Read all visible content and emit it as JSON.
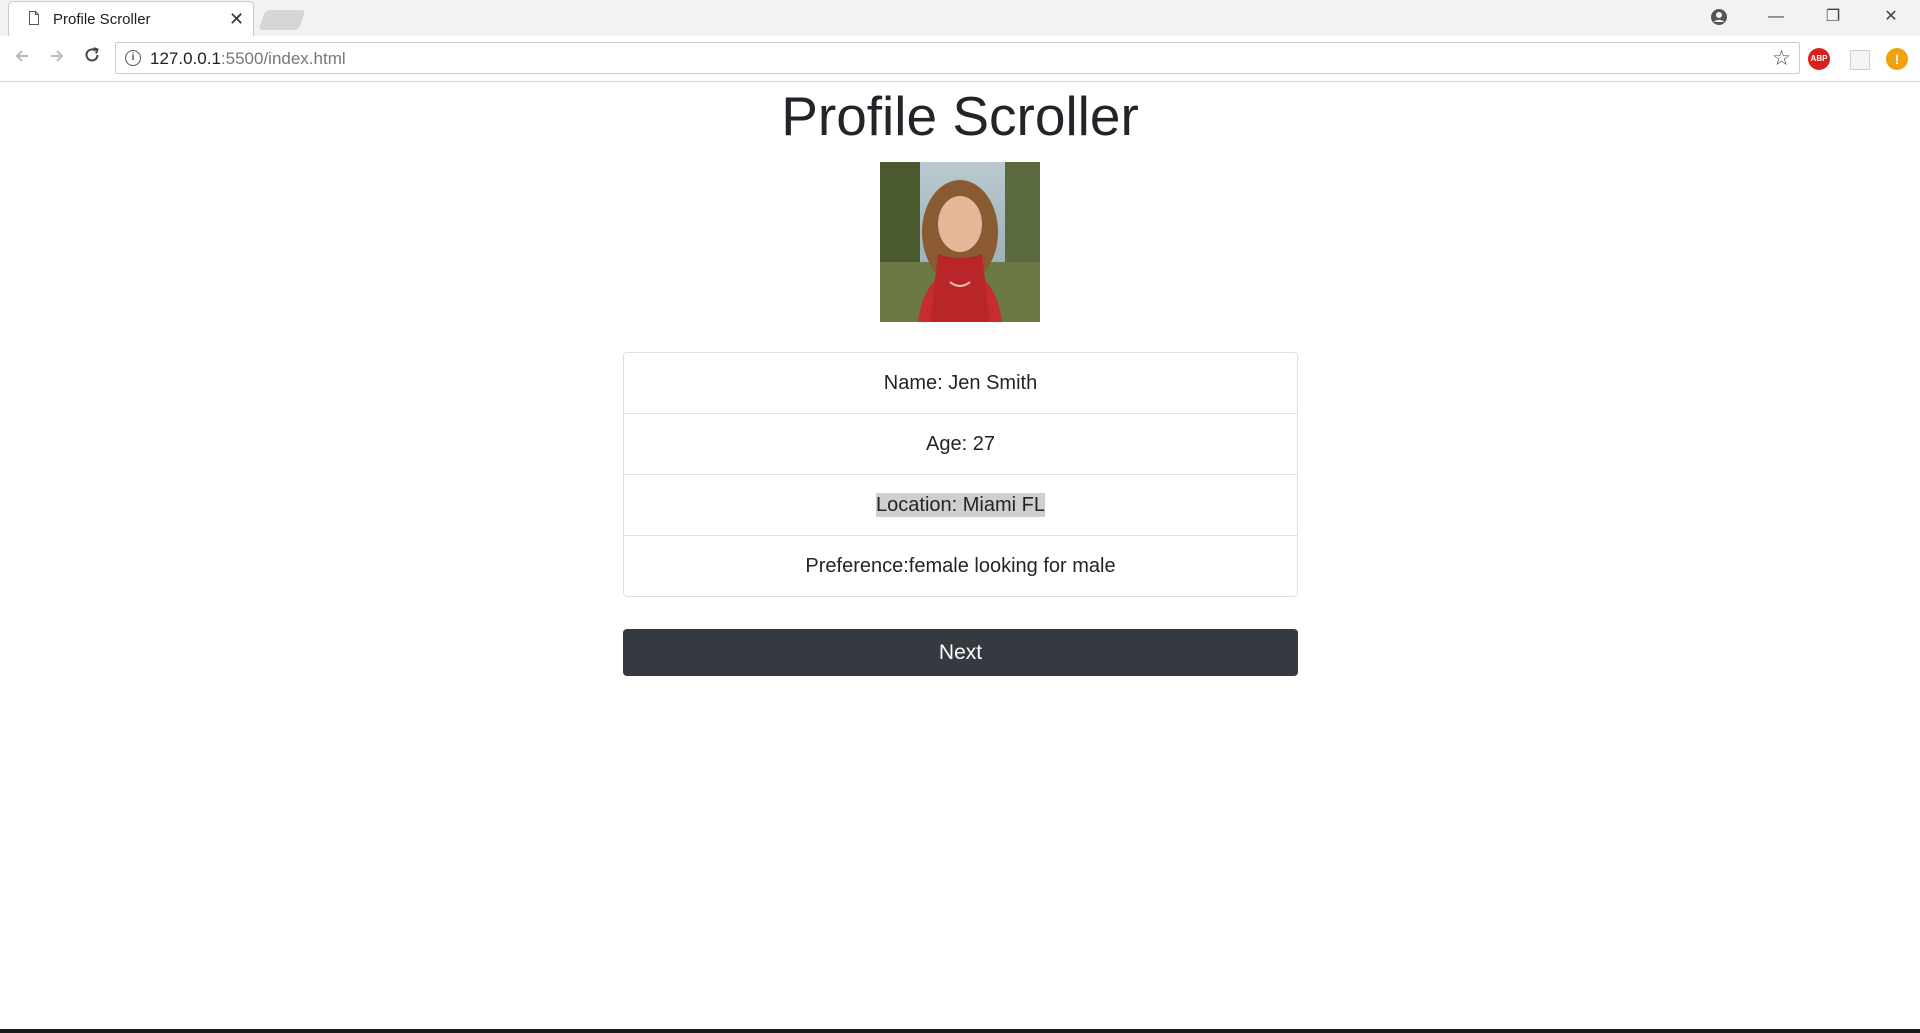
{
  "browser": {
    "tab_title": "Profile Scroller",
    "tab_close": "✕",
    "url_host": "127.0.0.1",
    "url_path": ":5500/index.html",
    "window_controls": {
      "minimize": "—",
      "maximize": "❐",
      "close": "✕"
    },
    "extensions": {
      "abp_label": "ABP",
      "warning_label": "!"
    },
    "icons": [
      "document-icon",
      "account-icon",
      "back-arrow-icon",
      "forward-arrow-icon",
      "reload-icon",
      "info-icon",
      "star-icon"
    ]
  },
  "page": {
    "title": "Profile Scroller",
    "profile": {
      "name": "Name: Jen Smith",
      "age": "Age: 27",
      "location": "Location: Miami FL",
      "preference": "Preference:female looking for male"
    },
    "next_label": "Next"
  },
  "colors": {
    "button_bg": "#343a40",
    "text": "#212529",
    "selection": "#cfcfcf"
  }
}
